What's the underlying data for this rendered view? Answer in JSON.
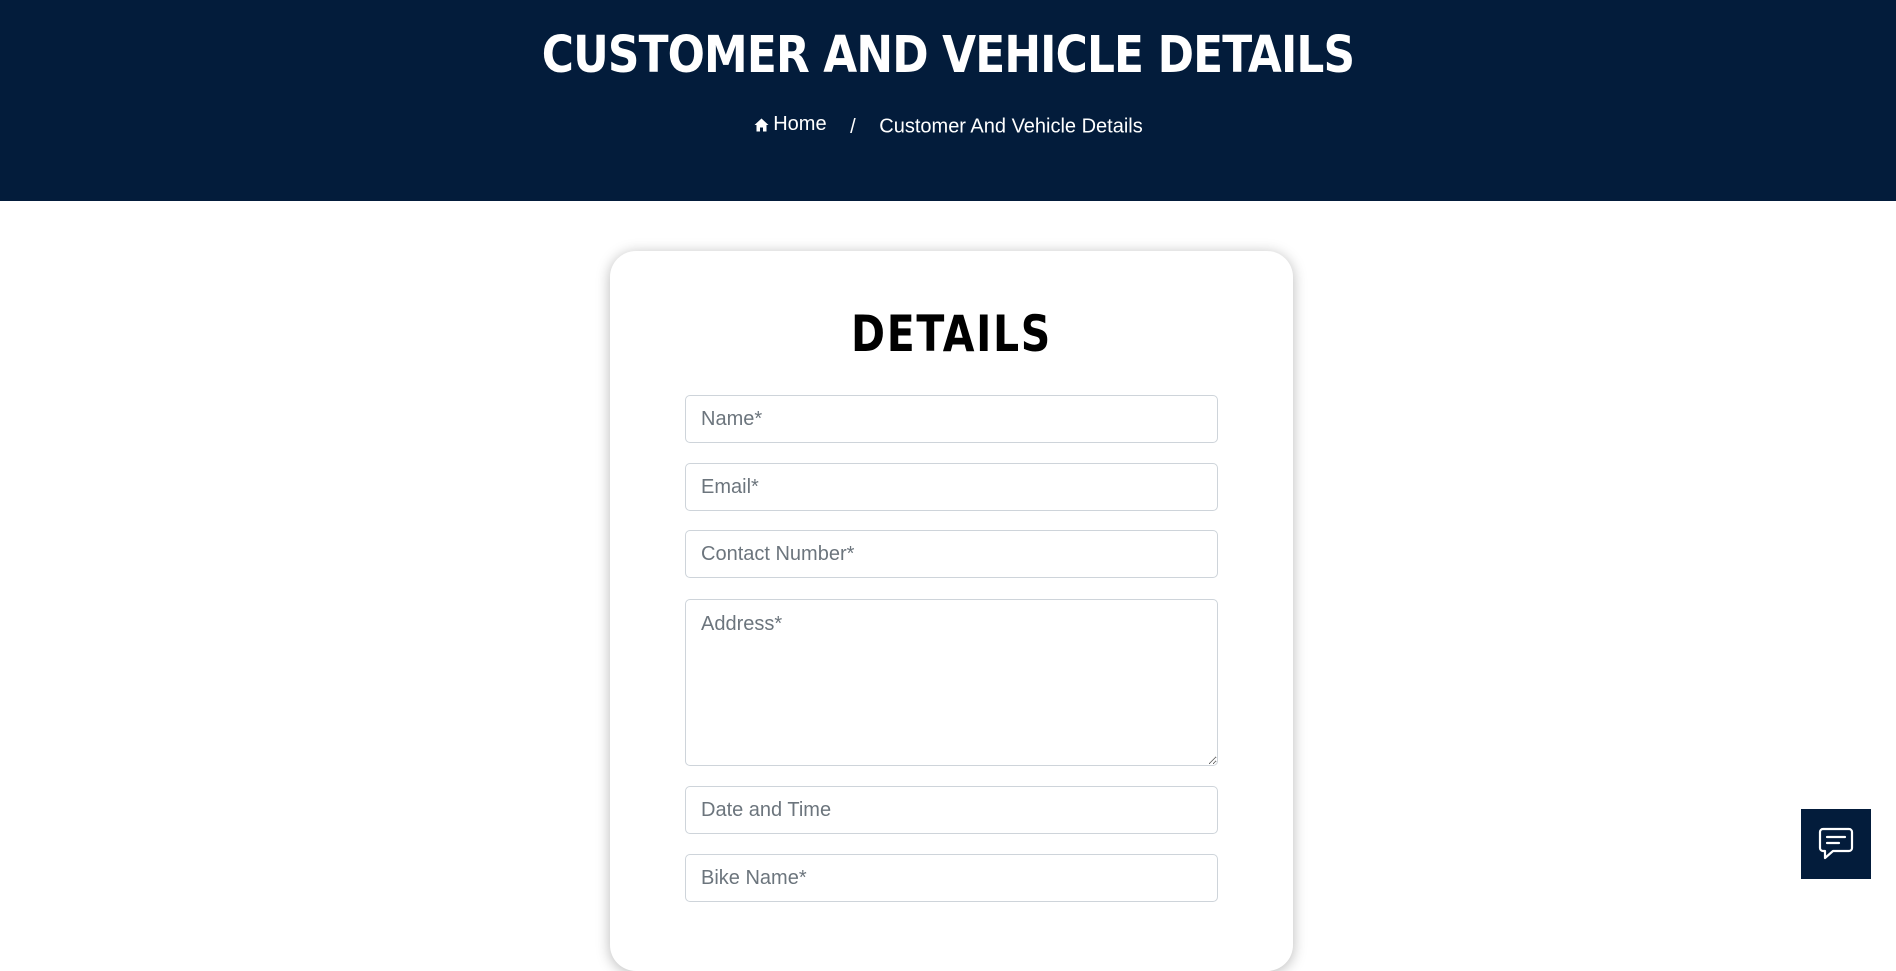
{
  "hero": {
    "title": "CUSTOMER AND VEHICLE DETAILS",
    "background": "#031c3b"
  },
  "breadcrumb": {
    "home_icon": "home-icon",
    "home_label": "Home",
    "separator": "/",
    "current": "Customer And Vehicle Details"
  },
  "form": {
    "title": "DETAILS",
    "name_placeholder": "Name*",
    "email_placeholder": "Email*",
    "contact_placeholder": "Contact Number*",
    "address_placeholder": "Address*",
    "datetime_placeholder": "Date and Time",
    "bike_placeholder": "Bike Name*"
  },
  "chat": {
    "icon": "chat-icon",
    "background": "#031c3b"
  }
}
